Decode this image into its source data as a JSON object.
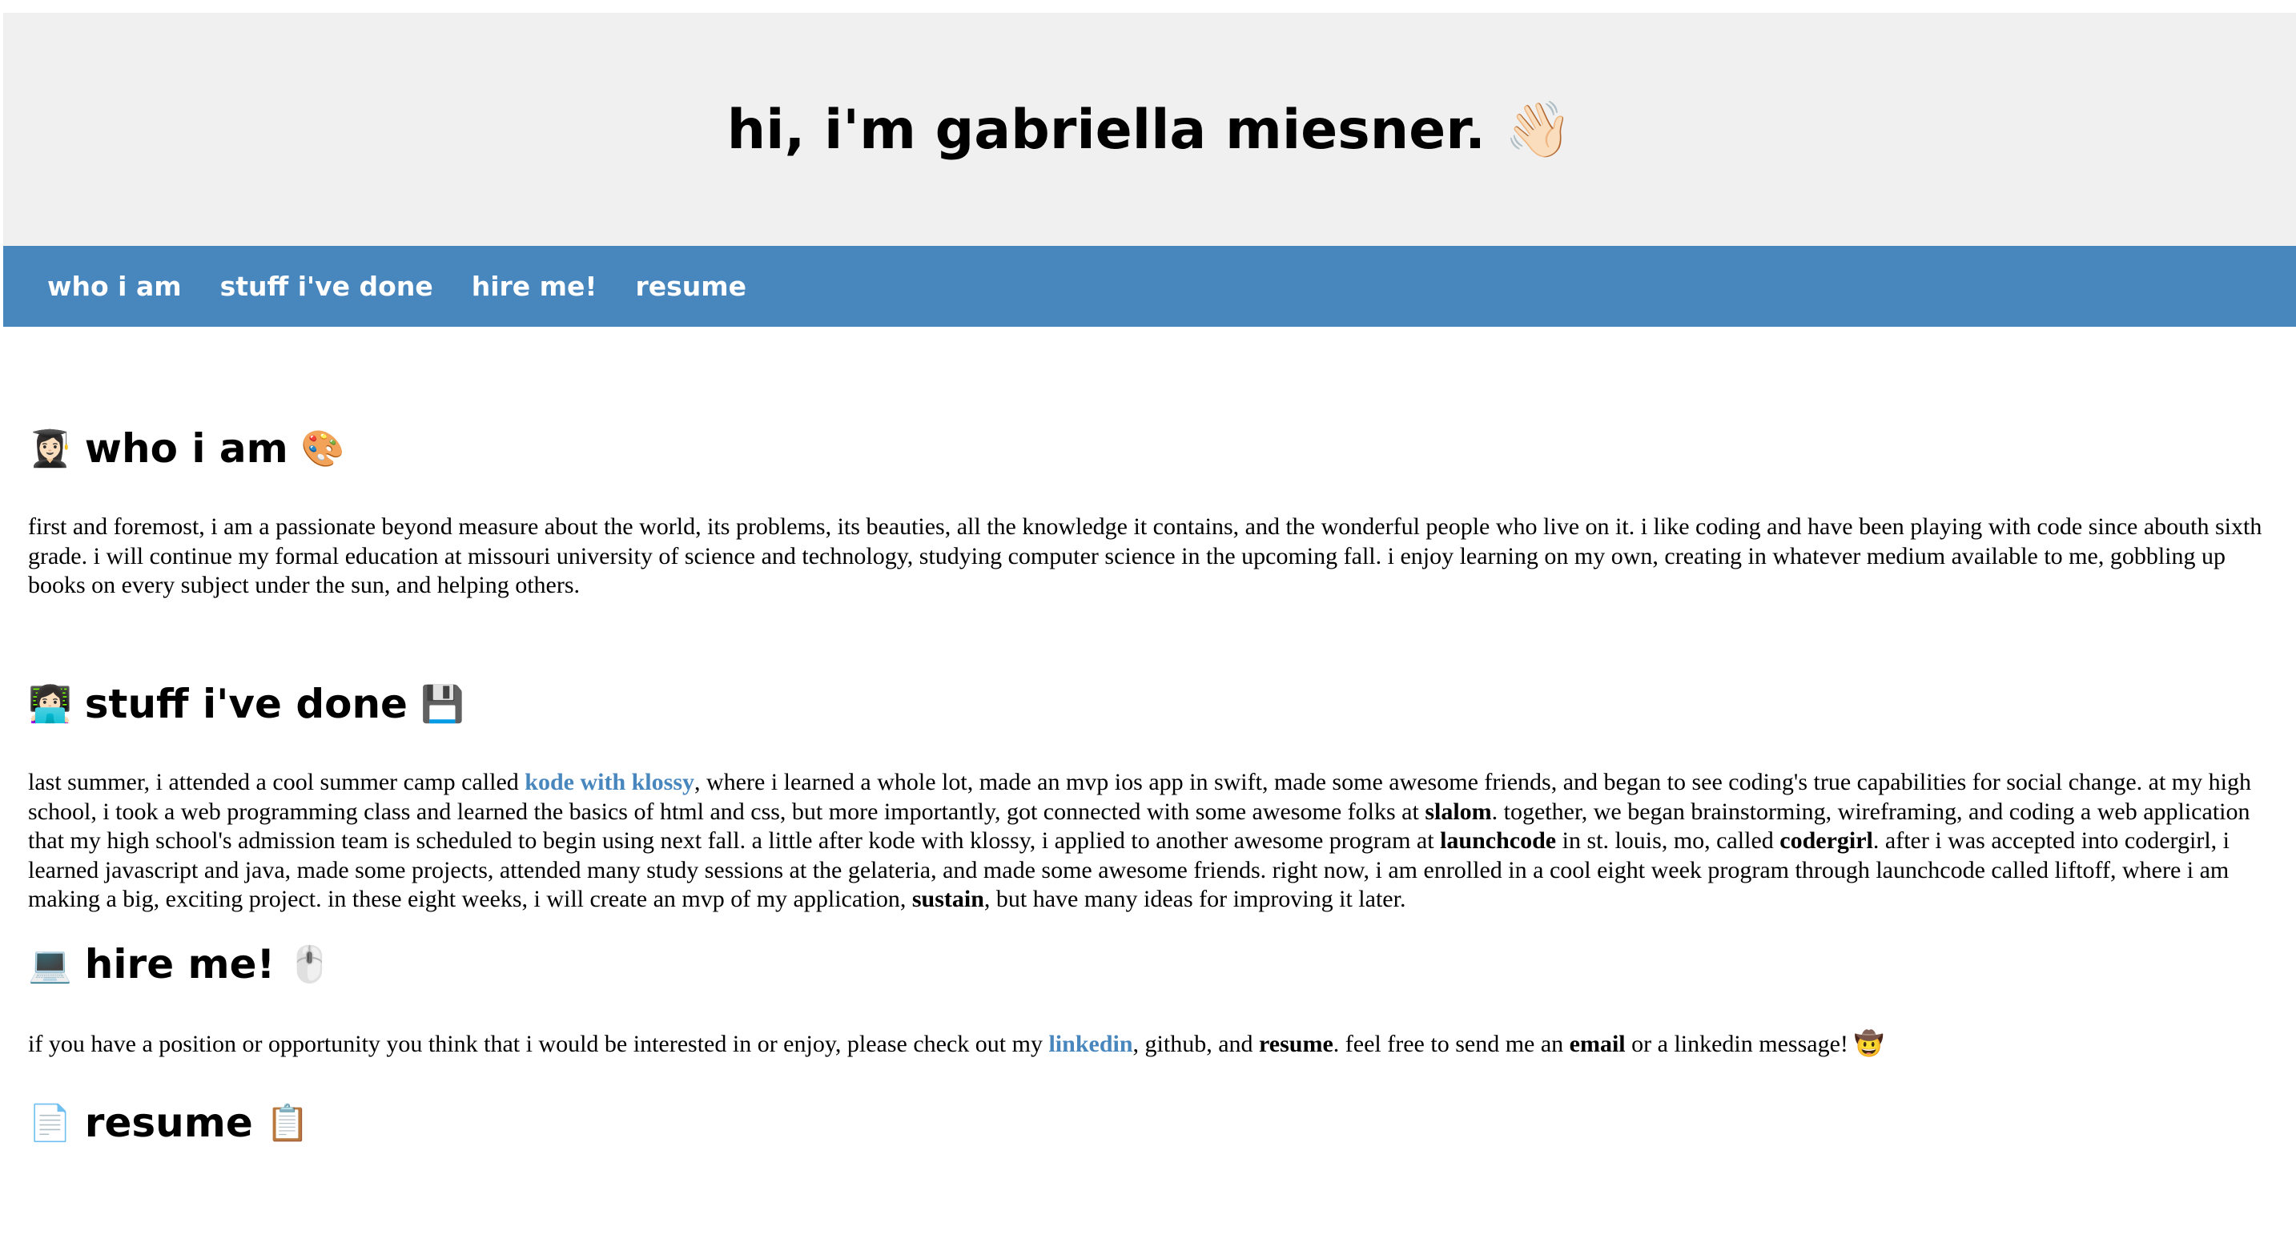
{
  "header": {
    "title": "hi, i'm gabriella miesner. 👋🏻"
  },
  "nav": {
    "items": [
      {
        "label": "who i am"
      },
      {
        "label": "stuff i've done"
      },
      {
        "label": "hire me!"
      },
      {
        "label": "resume"
      }
    ]
  },
  "sections": {
    "who": {
      "emoji_before": "👩🏻‍🎓",
      "title": "who i am",
      "emoji_after": "🎨",
      "text": "first and foremost, i am a passionate beyond measure about the world, its problems, its beauties, all the knowledge it contains, and the wonderful people who live on it. i like coding and have been playing with code since abouth sixth grade. i will continue my formal education at missouri university of science and technology, studying computer science in the upcoming fall. i enjoy learning on my own, creating in whatever medium available to me, gobbling up books on every subject under the sun, and helping others."
    },
    "done": {
      "emoji_before": "👩🏻‍💻",
      "title": "stuff i've done",
      "emoji_after": "💾",
      "t1": "last summer, i attended a cool summer camp called ",
      "link_klossy": "kode with klossy",
      "t2": ", where i learned a whole lot, made an mvp ios app in swift, made some awesome friends, and began to see coding's true capabilities for social change. at my high school, i took a web programming class and learned the basics of html and css, but more importantly, got connected with some awesome folks at ",
      "b_slalom": "slalom",
      "t3": ". together, we began brainstorming, wireframing, and coding a web application that my high school's admission team is scheduled to begin using next fall. a little after kode with klossy, i applied to another awesome program at ",
      "b_launchcode": "launchcode",
      "t4": " in st. louis, mo, called ",
      "b_codergirl": "codergirl",
      "t5": ". after i was accepted into codergirl, i learned javascript and java, made some projects, attended many study sessions at the gelateria, and made some awesome friends. right now, i am enrolled in a cool eight week program through launchcode called liftoff, where i am making a big, exciting project. in these eight weeks, i will create an mvp of my application, ",
      "b_sustain": "sustain",
      "t6": ", but have many ideas for improving it later."
    },
    "hire": {
      "emoji_before": "💻",
      "title": "hire me!",
      "emoji_after": "🖱️",
      "t1": "if you have a position or opportunity you think that i would be interested in or enjoy, please check out my ",
      "link_linkedin": "linkedin",
      "t2": ", github, and ",
      "b_resume": "resume",
      "t3": ". feel free to send me an ",
      "b_email": "email",
      "t4": " or a linkedin message! 🤠"
    },
    "resume": {
      "emoji_before": "📄",
      "title": "resume",
      "emoji_after": "📋"
    }
  },
  "colors": {
    "accent": "#4886be",
    "header_bg": "#f0f0f0"
  }
}
